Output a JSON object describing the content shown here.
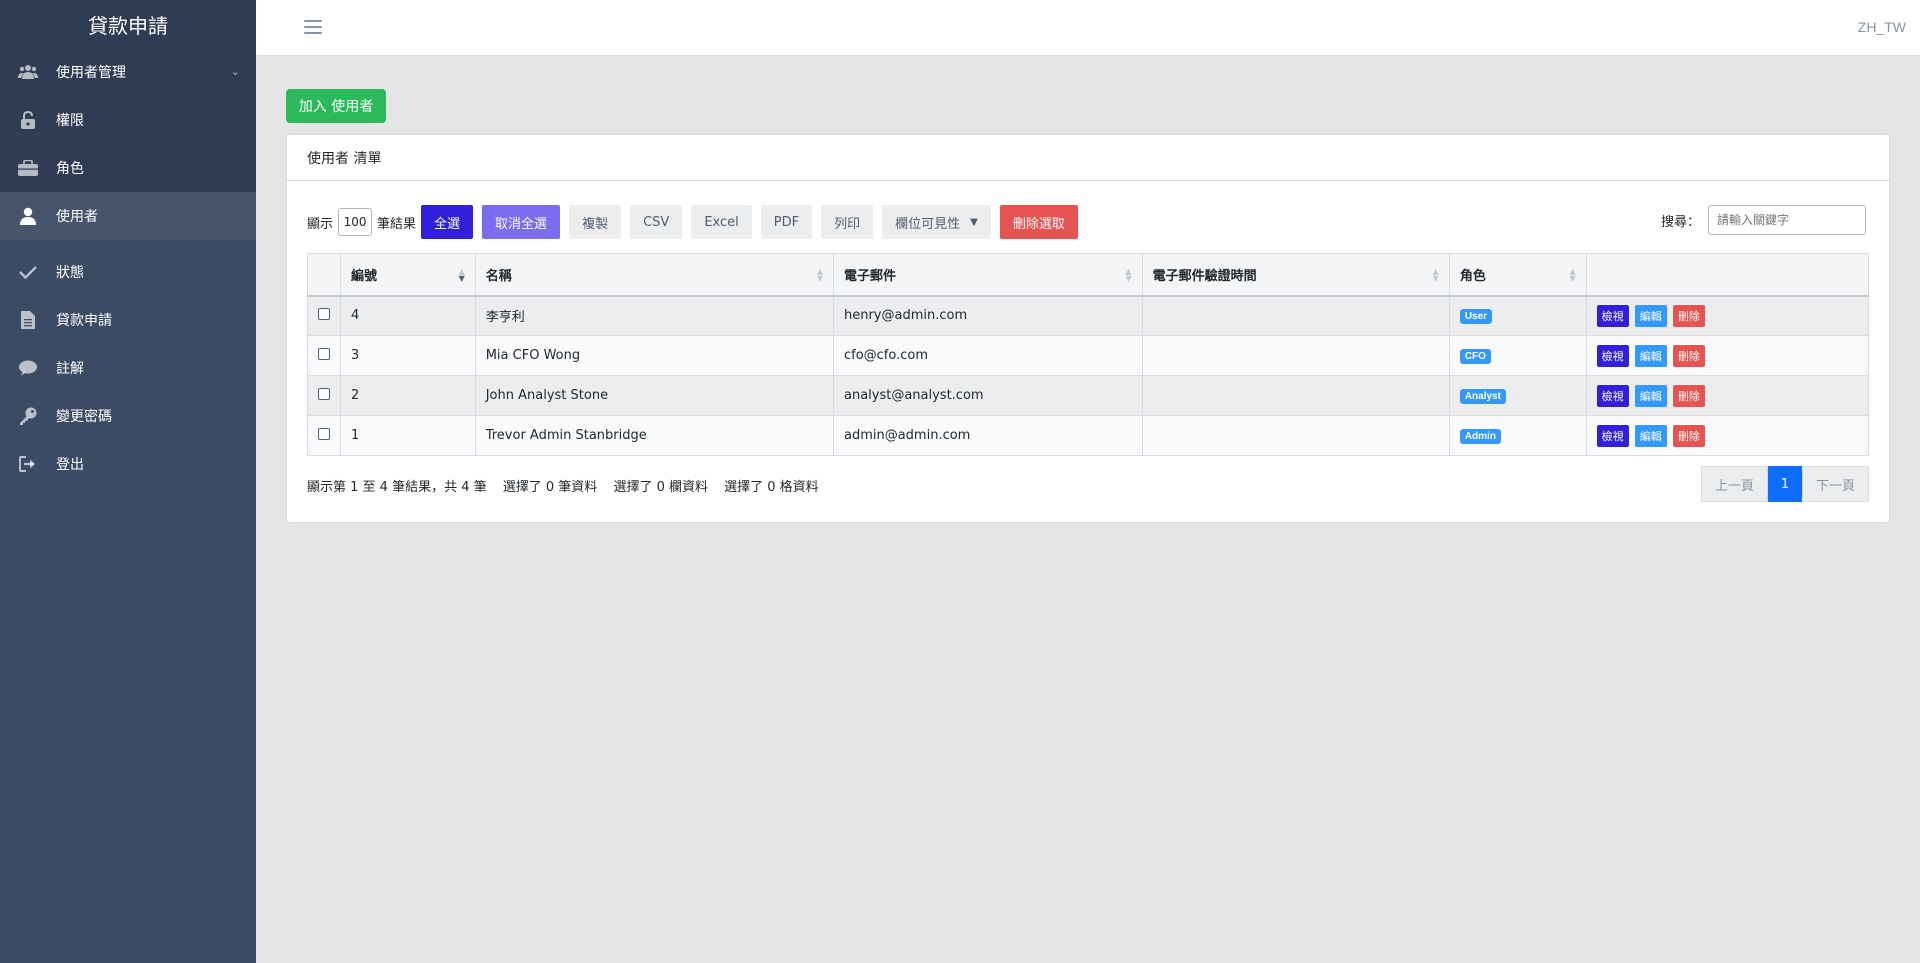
{
  "app": {
    "brand": "貸款申請",
    "locale": "ZH_TW"
  },
  "sidebar": {
    "items": [
      {
        "label": "使用者管理",
        "icon": "users-icon"
      },
      {
        "label": "權限",
        "icon": "unlock-icon"
      },
      {
        "label": "角色",
        "icon": "briefcase-icon"
      },
      {
        "label": "使用者",
        "icon": "user-icon"
      },
      {
        "label": "狀態",
        "icon": "check-icon"
      },
      {
        "label": "貸款申請",
        "icon": "document-icon"
      },
      {
        "label": "註解",
        "icon": "comment-icon"
      },
      {
        "label": "變更密碼",
        "icon": "key-icon"
      },
      {
        "label": "登出",
        "icon": "logout-icon"
      }
    ]
  },
  "main": {
    "add_button": "加入 使用者",
    "card_title": "使用者 清單",
    "toolbar": {
      "show_label": "顯示",
      "length_value": "100",
      "entries_label": "筆結果",
      "select_all": "全選",
      "deselect_all": "取消全選",
      "copy": "複製",
      "csv": "CSV",
      "excel": "Excel",
      "pdf": "PDF",
      "print": "列印",
      "colvis": "欄位可見性",
      "delete_selected": "刪除選取"
    },
    "search": {
      "label": "搜尋：",
      "placeholder": "請輸入關鍵字"
    },
    "table": {
      "columns": [
        "編號",
        "名稱",
        "電子郵件",
        "電子郵件驗證時間",
        "角色"
      ],
      "rows": [
        {
          "id": "4",
          "name": "李亨利",
          "email": "henry@admin.com",
          "verified": "",
          "role": "User"
        },
        {
          "id": "3",
          "name": "Mia CFO Wong",
          "email": "cfo@cfo.com",
          "verified": "",
          "role": "CFO"
        },
        {
          "id": "2",
          "name": "John Analyst Stone",
          "email": "analyst@analyst.com",
          "verified": "",
          "role": "Analyst"
        },
        {
          "id": "1",
          "name": "Trevor Admin Stanbridge",
          "email": "admin@admin.com",
          "verified": "",
          "role": "Admin"
        }
      ],
      "actions": {
        "view": "檢視",
        "edit": "編輯",
        "delete": "刪除"
      }
    },
    "info": {
      "showing": "顯示第 1 至 4 筆結果，共 4 筆",
      "sel_rows": "選擇了 0 筆資料",
      "sel_cols": "選擇了 0 欄資料",
      "sel_cells": "選擇了 0 格資料"
    },
    "pagination": {
      "prev": "上一頁",
      "current": "1",
      "next": "下一頁"
    }
  },
  "colors": {
    "sidebar": "#3c4b64",
    "primary": "#321fdb",
    "success": "#2eb85c",
    "danger": "#e55353",
    "info": "#3399ff"
  }
}
